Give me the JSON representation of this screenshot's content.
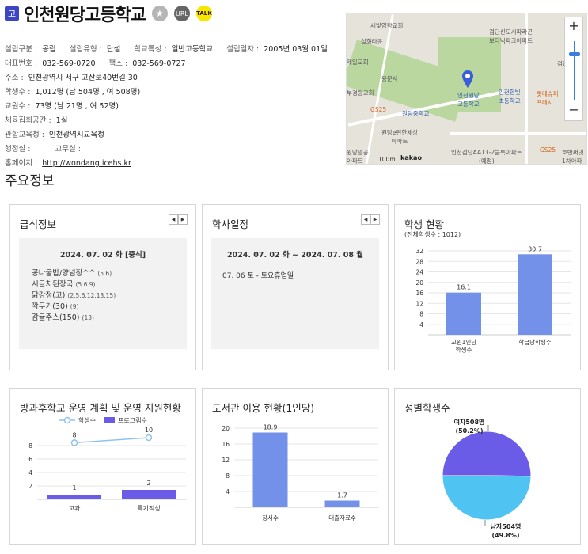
{
  "header": {
    "badge": "고",
    "school_name": "인천원당고등학교",
    "star_icon": "★",
    "url_label": "URL",
    "talk_label": "TALK"
  },
  "info": {
    "type_k": "설립구분 :",
    "type_v": "공립",
    "kind_k": "설립유형 :",
    "kind_v": "단설",
    "char_k": "학교특성 :",
    "char_v": "일반고등학교",
    "date_k": "설립일자 :",
    "date_v": "2005년 03월 01일",
    "tel_k": "대표번호 :",
    "tel_v": "032-569-0720",
    "fax_k": "팩스 :",
    "fax_v": "032-569-0727",
    "addr_k": "주소 :",
    "addr_v": "인천광역시 서구 고산로40번길 30",
    "students_k": "학생수 :",
    "students_v": "1,012명 (남 504명 , 여 508명)",
    "teachers_k": "교원수 :",
    "teachers_v": "73명 (남 21명 , 여 52명)",
    "gym_k": "체육집회공간 :",
    "gym_v": "1실",
    "office_k": "관할교육청 :",
    "office_v": "인천광역시교육청",
    "admin_k": "행정실 :",
    "staff_k": "교무실 :",
    "home_k": "홈페이지 :",
    "home_v": "http://wondang.icehs.kr"
  },
  "map": {
    "labels": {
      "church": "세빛영락교회",
      "seolhwa": "설화타운",
      "jeil": "제일교회",
      "yongmun": "용문사",
      "bujeong": "부경랑교회",
      "gs25a": "GS25",
      "wondang_mid": "원당중학교",
      "wondang_high": "인천원당\n고등학교",
      "wondang_elem": "인천한빛\n초등학교",
      "lotte": "롯데슈퍼\n프레시",
      "geomdan_apt": "검단신도시파라곤\n보타닉파크아파트",
      "geomdan": "검단",
      "eapt": "원당e편한세상\n아파트",
      "geomdan_aa": "인천검단AA13-2블록아파트\n(예정)",
      "gs25b": "GS25",
      "hoban": "호반써밋\n1차아파",
      "wanggong": "원당광공\n아파트",
      "scale": "100m",
      "kakao": "kakao"
    },
    "zoom_in": "+",
    "zoom_out": "−"
  },
  "section_title": "주요정보",
  "meal": {
    "title": "급식정보",
    "prev": "◀",
    "next": "▶",
    "date": "2024. 07. 02 화 [중식]",
    "items": [
      {
        "name": "콩나물밥/양념장^^",
        "code": "(5.6)"
      },
      {
        "name": "시금치된장국",
        "code": "(5.6.9)"
      },
      {
        "name": "닭강정(고)",
        "code": "(2.5.6.12.13.15)"
      },
      {
        "name": "깍두기(30)",
        "code": "(9)"
      },
      {
        "name": "감귤주스(150)",
        "code": "(13)"
      }
    ]
  },
  "schedule": {
    "title": "학사일정",
    "prev": "◀",
    "next": "▶",
    "date": "2024. 07. 02 화 ~ 2024. 07. 08 월",
    "item": "07. 06 토 - 토요휴업일"
  },
  "student_status": {
    "title": "학생 현황",
    "subtitle": "(전체학생수 : 1012)"
  },
  "afterschool": {
    "title": "방과후학교 운영 계획 및 운영 지원현황"
  },
  "library": {
    "title": "도서관 이용 현황(1인당)"
  },
  "gender": {
    "title": "성별학생수"
  },
  "colors": {
    "bar": "#7391e8",
    "line": "#8ec3ef",
    "program": "#6b5ce7",
    "female": "#6b5ce7",
    "male": "#4fc4f2",
    "badge": "#3b46c4"
  },
  "chart_data": [
    {
      "type": "bar",
      "title": "학생 현황",
      "subtitle": "(전체학생수 : 1012)",
      "categories": [
        "교원1인당\n학생수",
        "학급당학생수"
      ],
      "values": [
        16.1,
        30.7
      ],
      "ylim": [
        0,
        32
      ],
      "yticks": [
        4,
        8,
        12,
        16,
        20,
        24,
        28,
        32
      ]
    },
    {
      "type": "bar",
      "title": "방과후학교 운영 계획 및 운영 지원현황",
      "categories": [
        "교과",
        "특기적성"
      ],
      "series": [
        {
          "name": "학생수",
          "kind": "line",
          "values": [
            8,
            10
          ]
        },
        {
          "name": "프로그램수",
          "kind": "bar",
          "values": [
            1,
            2
          ]
        }
      ],
      "yticks": [
        2,
        4,
        6,
        8
      ]
    },
    {
      "type": "bar",
      "title": "도서관 이용 현황(1인당)",
      "categories": [
        "장서수",
        "대출자료수"
      ],
      "values": [
        18.9,
        1.7
      ],
      "ylim": [
        0,
        20
      ],
      "yticks": [
        4,
        8,
        12,
        16,
        20
      ]
    },
    {
      "type": "pie",
      "title": "성별학생수",
      "slices": [
        {
          "label": "여자508명",
          "pct": "(50.2%)",
          "value": 508
        },
        {
          "label": "남자504명",
          "pct": "(49.8%)",
          "value": 504
        }
      ]
    }
  ]
}
